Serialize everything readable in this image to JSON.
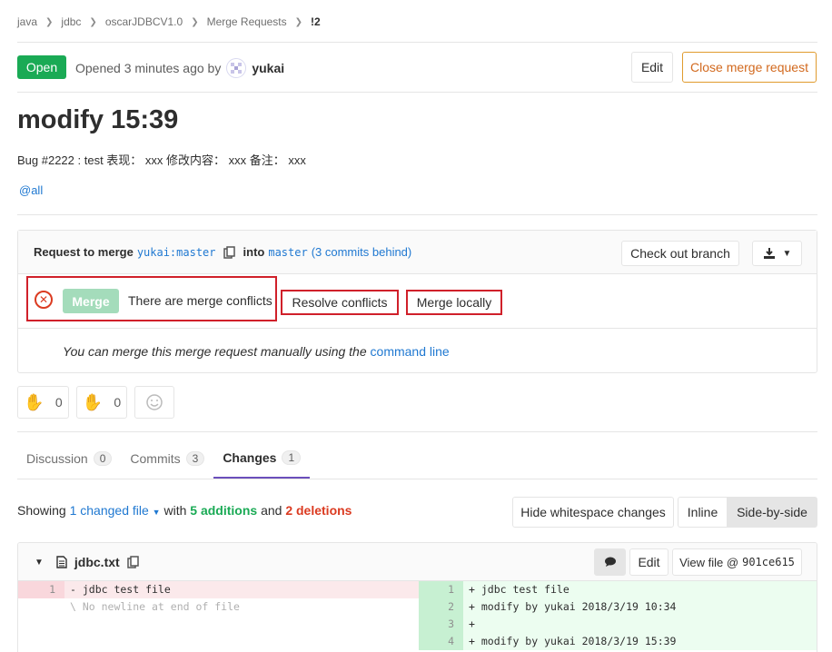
{
  "breadcrumb": [
    "java",
    "jdbc",
    "oscarJDBCV1.0",
    "Merge Requests",
    "!2"
  ],
  "header": {
    "status": "Open",
    "opened_text": "Opened 3 minutes ago by",
    "author": "yukai",
    "edit_label": "Edit",
    "close_label": "Close merge request"
  },
  "mr": {
    "title": "modify 15:39",
    "description": "Bug #2222 : test 表现： xxx 修改内容： xxx 备注： xxx",
    "mention": "@all"
  },
  "widget": {
    "request_to_merge": "Request to merge",
    "source_branch": "yukai:master",
    "into": "into",
    "target_branch": "master",
    "behind": "(3 commits behind)",
    "checkout_label": "Check out branch",
    "merge_label": "Merge",
    "conflicts_text": "There are merge conflicts",
    "resolve_label": "Resolve conflicts",
    "merge_locally_label": "Merge locally",
    "manual_text": "You can merge this merge request manually using the",
    "command_line": "command line"
  },
  "awards": {
    "thumbsup_count": "0",
    "thumbsdown_count": "0"
  },
  "tabs": [
    {
      "label": "Discussion",
      "count": "0"
    },
    {
      "label": "Commits",
      "count": "3"
    },
    {
      "label": "Changes",
      "count": "1"
    }
  ],
  "changes": {
    "showing": "Showing",
    "changed_files": "1 changed file",
    "with": "with",
    "additions": "5 additions",
    "and": "and",
    "deletions": "2 deletions",
    "hide_whitespace": "Hide whitespace changes",
    "inline": "Inline",
    "side_by_side": "Side-by-side"
  },
  "file": {
    "name": "jdbc.txt",
    "edit_label": "Edit",
    "view_label": "View file @",
    "commit_sha": "901ce615"
  },
  "diff": {
    "old": [
      {
        "ln": "1",
        "text": "- jdbc test file"
      },
      {
        "ln": "",
        "text": "  \\ No newline at end of file"
      }
    ],
    "new": [
      {
        "ln": "1",
        "text": "+ jdbc test file"
      },
      {
        "ln": "2",
        "text": "+ modify by yukai 2018/3/19 10:34"
      },
      {
        "ln": "3",
        "text": "+"
      },
      {
        "ln": "4",
        "text": "+ modify by yukai 2018/3/19 15:39"
      }
    ]
  },
  "colors": {
    "open_green": "#1aaa55",
    "link_blue": "#1f78d1",
    "danger_red": "#db3b21",
    "highlight_box": "#d0202a",
    "tab_underline": "#6b4fbb"
  }
}
